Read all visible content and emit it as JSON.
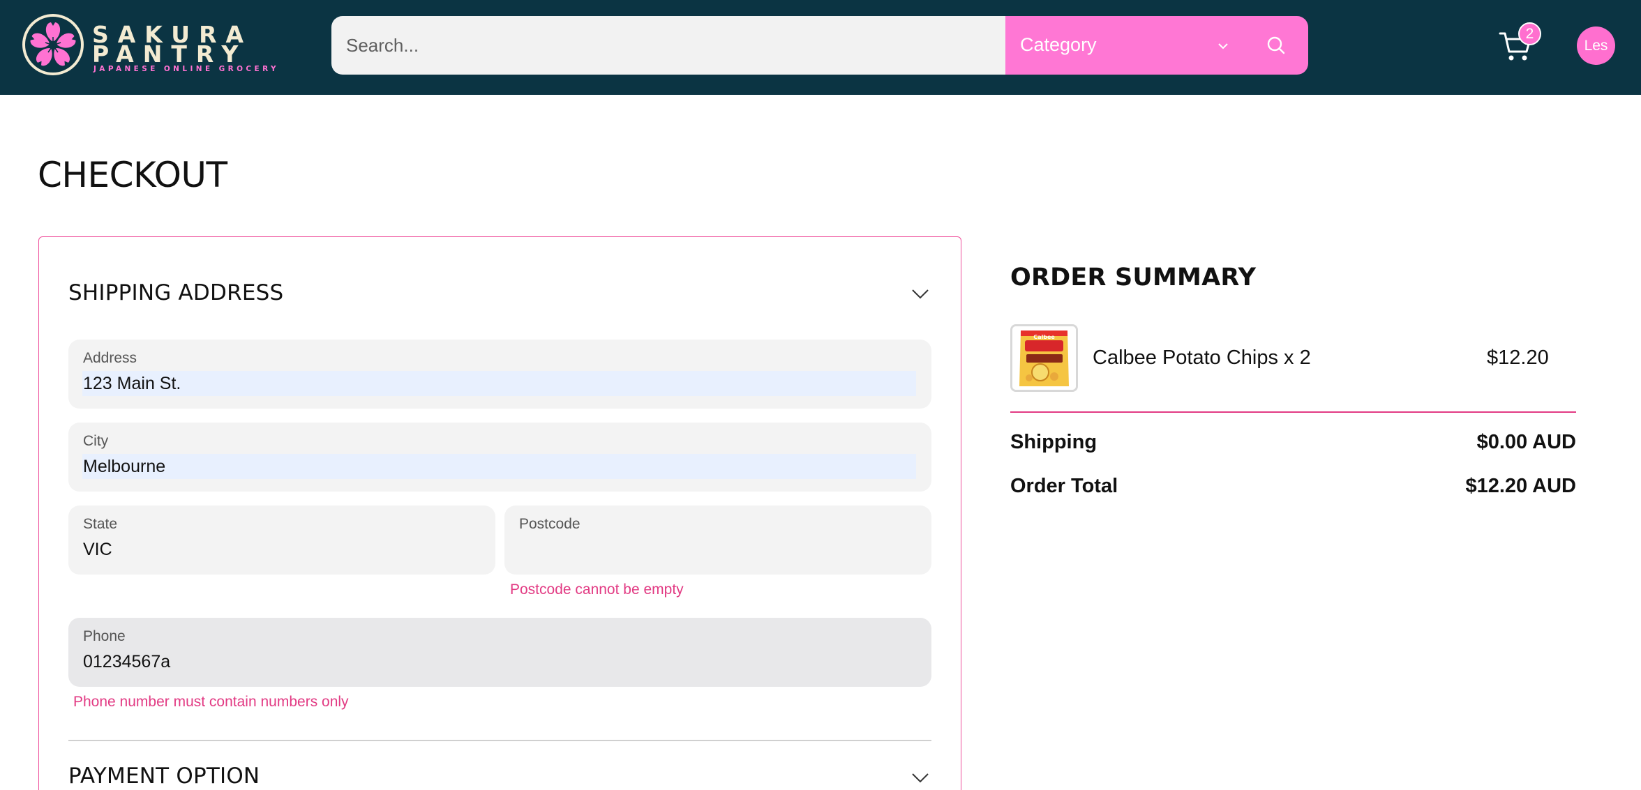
{
  "brand": {
    "name_line1": "SAKURA",
    "name_line2": "PANTRY",
    "tagline": "JAPANESE ONLINE GROCERY",
    "colors": {
      "header_bg": "#0b3443",
      "accent_pink": "#ff77d4",
      "error": "#e23a83"
    }
  },
  "header": {
    "search": {
      "placeholder": "Search...",
      "value": ""
    },
    "category": {
      "label": "Category"
    },
    "icons": {
      "search": "search-icon",
      "chevron": "chevron-down-icon",
      "cart": "cart-icon"
    },
    "cart_count": "2",
    "user_initials": "Les"
  },
  "page": {
    "title": "CHECKOUT"
  },
  "shipping": {
    "title": "SHIPPING ADDRESS",
    "fields": {
      "address": {
        "label": "Address",
        "value": "123 Main St."
      },
      "city": {
        "label": "City",
        "value": "Melbourne"
      },
      "state": {
        "label": "State",
        "value": "VIC"
      },
      "postcode": {
        "label": "Postcode",
        "value": "",
        "error": "Postcode cannot be empty"
      },
      "phone": {
        "label": "Phone",
        "value": "01234567a",
        "error": "Phone number must contain numbers only"
      }
    }
  },
  "payment": {
    "title": "PAYMENT OPTION"
  },
  "summary": {
    "title": "ORDER SUMMARY",
    "items": [
      {
        "name": "Calbee Potato Chips x 2",
        "price": "$12.20",
        "image_text": "Calbee"
      }
    ],
    "shipping_label": "Shipping",
    "shipping_value": "$0.00 AUD",
    "total_label": "Order Total",
    "total_value": "$12.20 AUD"
  }
}
